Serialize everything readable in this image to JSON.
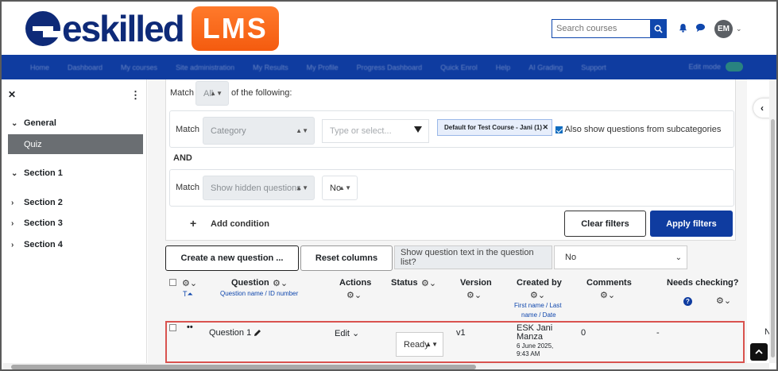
{
  "header": {
    "logo_text": "eskilled",
    "logo_badge": "LMS",
    "search_placeholder": "Search courses",
    "avatar_initials": "EM"
  },
  "nav": {
    "items": [
      "Home",
      "Dashboard",
      "My courses",
      "Site administration",
      "My Results",
      "My Profile",
      "Progress Dashboard",
      "Quick Enrol",
      "Help",
      "AI Grading",
      "Support"
    ],
    "edit_mode_label": "Edit mode"
  },
  "sidebar": {
    "sections": [
      {
        "label": "General",
        "expanded": true
      },
      {
        "label": "Section 1",
        "expanded": true
      },
      {
        "label": "Section 2",
        "expanded": false
      },
      {
        "label": "Section 3",
        "expanded": false
      },
      {
        "label": "Section 4",
        "expanded": false
      }
    ],
    "active_item": "Quiz"
  },
  "filters": {
    "match_label": "Match",
    "match_value": "All",
    "of_following": "of the following:",
    "condition1": {
      "match_label": "Match",
      "field": "Category",
      "type_placeholder": "Type or select...",
      "chip": "Default for Test Course - Jani (1)",
      "subcat_label": "Also show questions from subcategories",
      "subcat_checked": true
    },
    "and_label": "AND",
    "condition2": {
      "match_label": "Match",
      "field": "Show hidden questions",
      "value": "No"
    },
    "add_condition": "Add condition",
    "clear_filters": "Clear filters",
    "apply_filters": "Apply filters"
  },
  "toolbar": {
    "create_question": "Create a new question ...",
    "reset_columns": "Reset columns",
    "show_text_label": "Show question text in the question list?",
    "show_text_value": "No"
  },
  "table": {
    "headers": {
      "t_label": "T",
      "question": "Question",
      "question_sub": "Question name / ID number",
      "actions": "Actions",
      "status": "Status",
      "version": "Version",
      "created_by": "Created by",
      "created_by_sub1": "First name / Last",
      "created_by_sub2": "name / Date",
      "comments": "Comments",
      "needs_checking": "Needs checking?"
    },
    "rows": [
      {
        "name": "Question 1",
        "action": "Edit",
        "status": "Ready",
        "version": "v1",
        "creator": "ESK Jani Manza",
        "date_line1": "6 June 2025,",
        "date_line2": "9:43 AM",
        "comments": "0",
        "needs_checking": "-",
        "overflow": "N"
      }
    ]
  }
}
